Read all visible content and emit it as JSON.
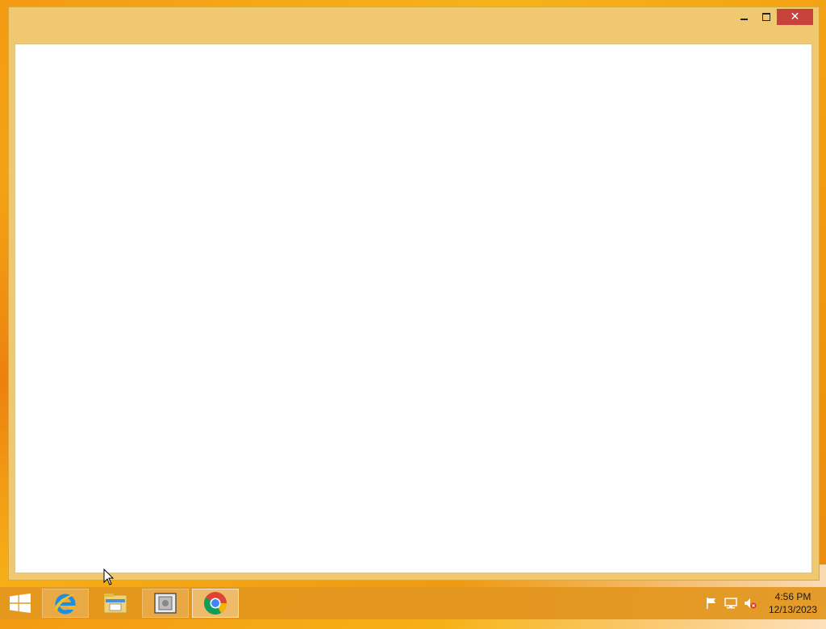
{
  "window": {
    "minimize_label": "minimize",
    "maximize_label": "maximize",
    "close_glyph": "✕"
  },
  "taskbar": {
    "start_icon": "windows-logo-icon",
    "pinned": [
      {
        "name": "Internet Explorer",
        "icon": "ie-icon"
      },
      {
        "name": "File Explorer",
        "icon": "folder-icon"
      },
      {
        "name": "Application",
        "icon": "app-window-icon"
      },
      {
        "name": "Google Chrome",
        "icon": "chrome-icon"
      }
    ],
    "tray": {
      "icons": [
        "flag-icon",
        "network-icon",
        "volume-muted-icon"
      ]
    },
    "clock": {
      "time": "4:56 PM",
      "date": "12/13/2023"
    }
  },
  "colors": {
    "desktop": "#f7b318",
    "titlebar": "#f0c870",
    "close_button": "#c7423a",
    "taskbar": "#e2961e"
  }
}
